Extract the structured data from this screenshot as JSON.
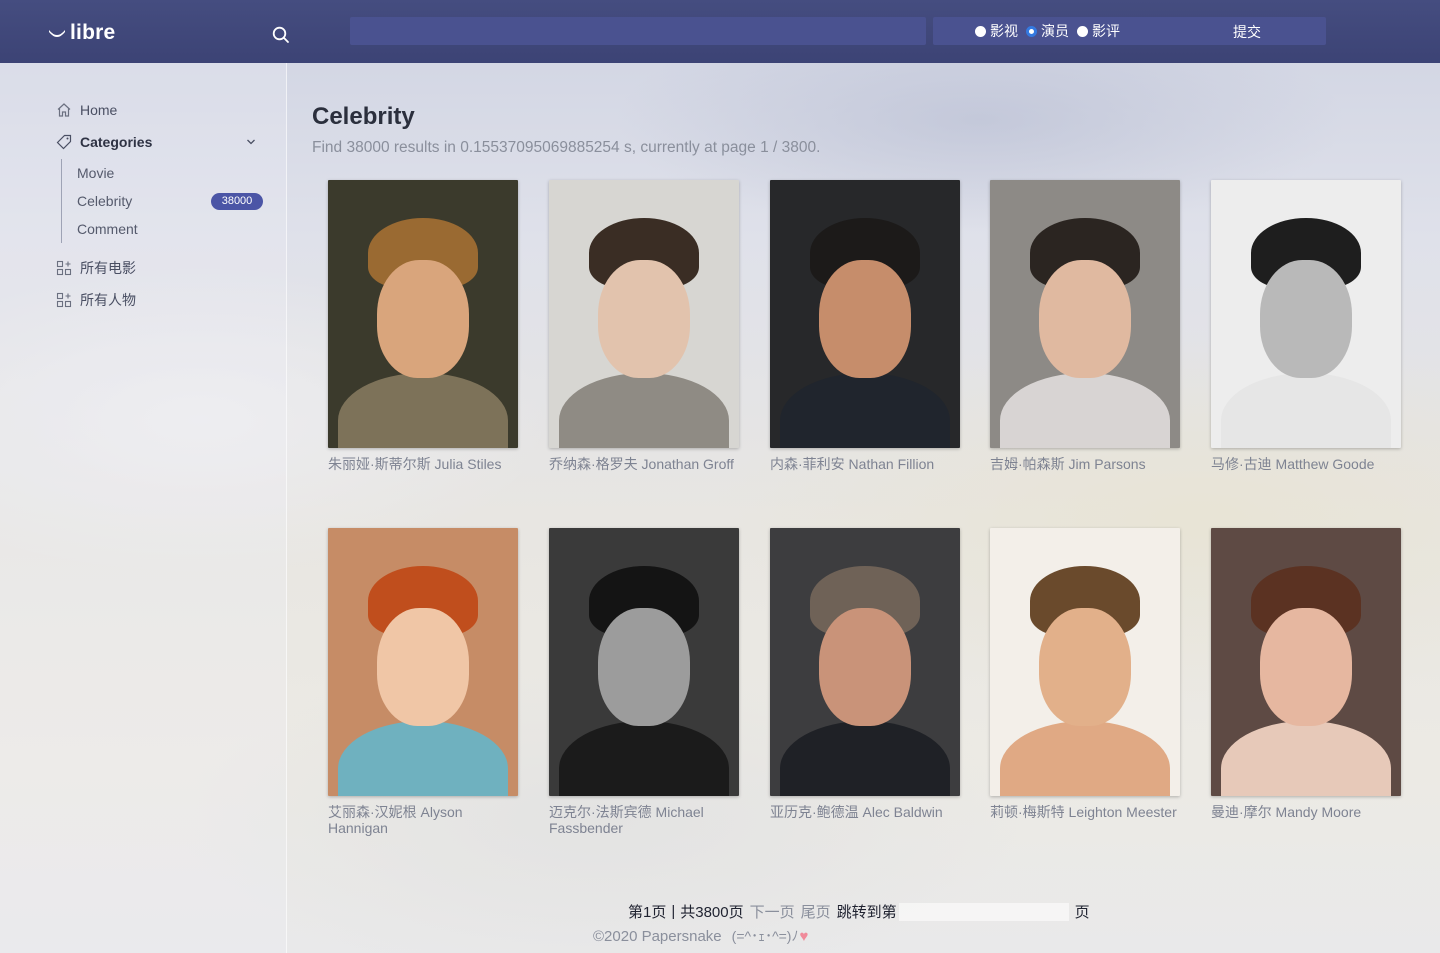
{
  "app": {
    "name": "libre"
  },
  "search": {
    "value": "",
    "placeholder": ""
  },
  "search_type": {
    "options": [
      {
        "label": "影视",
        "checked": false
      },
      {
        "label": "演员",
        "checked": true
      },
      {
        "label": "影评",
        "checked": false
      }
    ],
    "submit_label": "提交"
  },
  "sidebar": {
    "home": "Home",
    "categories": "Categories",
    "subitems": [
      "Movie",
      "Celebrity",
      "Comment"
    ],
    "celebrity_count": "38000",
    "all_movies": "所有电影",
    "all_people": "所有人物"
  },
  "main": {
    "title": "Celebrity",
    "result_summary": "Find 38000 results in 0.15537095069885254 s, currently at page 1 / 3800."
  },
  "celebrities": [
    {
      "name": "朱丽娅·斯蒂尔斯 Julia Stiles",
      "colors": {
        "bg": "#3b3a2c",
        "hair": "#9a6a32",
        "face": "#d9a57c",
        "body": "#7d7259"
      }
    },
    {
      "name": "乔纳森·格罗夫 Jonathan Groff",
      "colors": {
        "bg": "#d7d6d2",
        "hair": "#3a2d24",
        "face": "#e2c3ad",
        "body": "#8f8b84"
      }
    },
    {
      "name": "内森·菲利安 Nathan Fillion",
      "colors": {
        "bg": "#27282a",
        "hair": "#1c1a19",
        "face": "#c68d6b",
        "body": "#20252d"
      }
    },
    {
      "name": "吉姆·帕森斯 Jim Parsons",
      "colors": {
        "bg": "#8d8a86",
        "hair": "#2b2521",
        "face": "#e0b9a0",
        "body": "#d8d4d3"
      }
    },
    {
      "name": "马修·古迪 Matthew Goode",
      "colors": {
        "bg": "#ededed",
        "hair": "#1e1e1e",
        "face": "#b9b9b9",
        "body": "#e6e6e6"
      }
    },
    {
      "name": "艾丽森·汉妮根 Alyson Hannigan",
      "colors": {
        "bg": "#c68c66",
        "hair": "#c04e1d",
        "face": "#f0c6a6",
        "body": "#6fb1bf"
      }
    },
    {
      "name": "迈克尔·法斯宾德 Michael Fassbender",
      "colors": {
        "bg": "#3a3a3a",
        "hair": "#141414",
        "face": "#9c9c9c",
        "body": "#1b1b1b"
      }
    },
    {
      "name": "亚历克·鲍德温 Alec Baldwin",
      "colors": {
        "bg": "#3d3d3f",
        "hair": "#6f6257",
        "face": "#c99379",
        "body": "#1f2126"
      }
    },
    {
      "name": "莉顿·梅斯特 Leighton Meester",
      "colors": {
        "bg": "#f3efe9",
        "hair": "#6a4a2c",
        "face": "#e2b08a",
        "body": "#e0a984"
      }
    },
    {
      "name": "曼迪·摩尔 Mandy Moore",
      "colors": {
        "bg": "#5e4a44",
        "hair": "#5b3222",
        "face": "#e6b7a0",
        "body": "#e7c9b9"
      }
    }
  ],
  "pagination": {
    "current": "第1页",
    "separator": "|",
    "total": "共3800页",
    "next": "下一页",
    "last": "尾页",
    "jump_label": "跳转到第",
    "jump_suffix": "页",
    "jump_value": ""
  },
  "footer": {
    "text": "©2020 Papersnake",
    "emoticon": "(=^･ｪ･^=)ﾉ"
  },
  "icons": {
    "logo": "libre-smile-logo",
    "search": "search-icon",
    "home": "home-icon",
    "categories": "tag-icon",
    "chevron": "chevron-down-icon",
    "grid": "grid-add-icon",
    "heart": "heart-icon"
  },
  "colors": {
    "topbar": "#3f467a",
    "accent": "#4b55a6",
    "radio_checked": "#3479e0"
  }
}
